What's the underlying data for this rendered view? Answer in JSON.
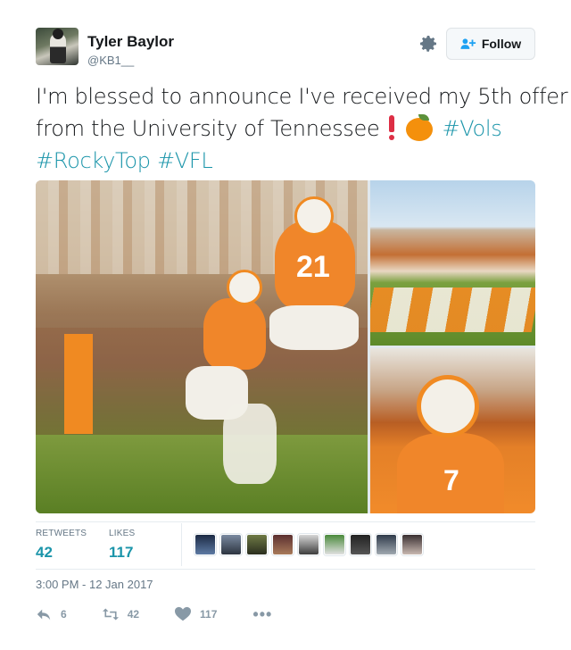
{
  "user": {
    "name": "Tyler Baylor",
    "handle": "@KB1__"
  },
  "header": {
    "follow_label": "Follow"
  },
  "tweet": {
    "line1": "I'm blessed to announce I've received my 5th offer",
    "line2_text": "from the University of Tennessee",
    "hashtag_vols": "#Vols",
    "hashtag_rockytop": "#RockyTop",
    "hashtag_vfl": "#VFL",
    "media_jersey_number": "21"
  },
  "stats": {
    "retweets_label": "RETWEETS",
    "retweets_value": "42",
    "likes_label": "LIKES",
    "likes_value": "117"
  },
  "liker_avatars": [
    "avatar-1",
    "avatar-2",
    "avatar-3",
    "avatar-4",
    "avatar-5",
    "avatar-6",
    "avatar-7",
    "avatar-8",
    "avatar-9"
  ],
  "timestamp": "3:00 PM - 12 Jan 2017",
  "actions": {
    "reply_count": "6",
    "retweet_count": "42",
    "like_count": "117"
  },
  "colors": {
    "accent": "#1b95aa",
    "link_blue": "#1da1f2",
    "muted": "#657786",
    "tennessee_orange": "#f08a22"
  },
  "icons": [
    "gear-icon",
    "follow-person-icon",
    "exclamation-emoji",
    "orange-emoji",
    "reply-icon",
    "retweet-icon",
    "heart-icon",
    "more-icon"
  ]
}
